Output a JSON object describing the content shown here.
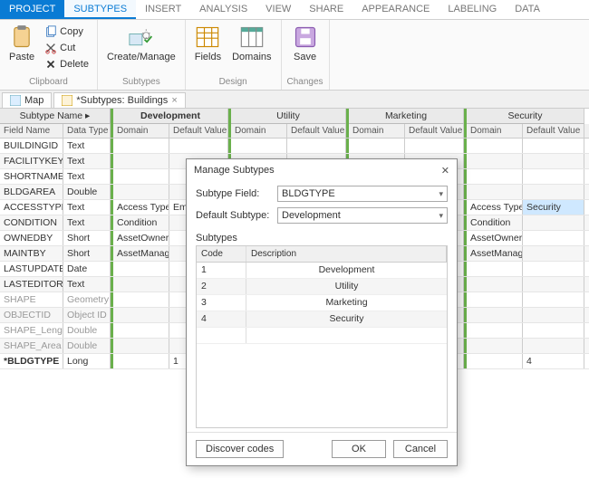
{
  "ribbonTabs": [
    "PROJECT",
    "SUBTYPES",
    "INSERT",
    "ANALYSIS",
    "VIEW",
    "SHARE",
    "APPEARANCE",
    "LABELING",
    "DATA"
  ],
  "activeTab": 1,
  "clipboard": {
    "copy": "Copy",
    "cut": "Cut",
    "delete": "Delete",
    "paste": "Paste",
    "label": "Clipboard"
  },
  "subtypesGroup": {
    "createManage": "Create/Manage",
    "label": "Subtypes"
  },
  "designGroup": {
    "fields": "Fields",
    "domains": "Domains",
    "label": "Design"
  },
  "changesGroup": {
    "save": "Save",
    "label": "Changes"
  },
  "docTabs": {
    "map": "Map",
    "subtypes": "*Subtypes: Buildings"
  },
  "gridHeaders": {
    "subtypeName": "Subtype Name ▸",
    "cols": [
      "Development",
      "Utility",
      "Marketing",
      "Security"
    ],
    "fieldName": "Field Name",
    "dataType": "Data Type",
    "domain": "Domain",
    "defaultValue": "Default Value"
  },
  "rows": [
    {
      "fn": "BUILDINGID",
      "dt": "Text"
    },
    {
      "fn": "FACILITYKEY",
      "dt": "Text"
    },
    {
      "fn": "SHORTNAME",
      "dt": "Text"
    },
    {
      "fn": "BLDGAREA",
      "dt": "Double"
    },
    {
      "fn": "ACCESSTYPE",
      "dt": "Text",
      "dom0": "Access Type",
      "dv0": "Emp",
      "dom3": "Access Type",
      "dv3": "Security",
      "hl3": true
    },
    {
      "fn": "CONDITION",
      "dt": "Text",
      "dom0": "Condition",
      "dom3": "Condition"
    },
    {
      "fn": "OWNEDBY",
      "dt": "Short",
      "dom0": "AssetOwner",
      "dom3": "AssetOwner"
    },
    {
      "fn": "MAINTBY",
      "dt": "Short",
      "dom0": "AssetManager",
      "dom3": "AssetManager"
    },
    {
      "fn": "LASTUPDATE",
      "dt": "Date"
    },
    {
      "fn": "LASTEDITOR",
      "dt": "Text"
    },
    {
      "fn": "SHAPE",
      "dt": "Geometry",
      "gray": true
    },
    {
      "fn": "OBJECTID",
      "dt": "Object ID",
      "gray": true
    },
    {
      "fn": "SHAPE_Length",
      "dt": "Double",
      "gray": true
    },
    {
      "fn": "SHAPE_Area",
      "dt": "Double",
      "gray": true
    },
    {
      "fn": "*BLDGTYPE",
      "dt": "Long",
      "bold": true,
      "dv0": "1",
      "dv3": "4"
    }
  ],
  "dialog": {
    "title": "Manage Subtypes",
    "subtypeFieldLabel": "Subtype Field:",
    "subtypeFieldValue": "BLDGTYPE",
    "defaultSubtypeLabel": "Default Subtype:",
    "defaultSubtypeValue": "Development",
    "subtypesLabel": "Subtypes",
    "codeHeader": "Code",
    "descHeader": "Description",
    "items": [
      {
        "code": "1",
        "desc": "Development"
      },
      {
        "code": "2",
        "desc": "Utility"
      },
      {
        "code": "3",
        "desc": "Marketing"
      },
      {
        "code": "4",
        "desc": "Security"
      }
    ],
    "discover": "Discover codes",
    "ok": "OK",
    "cancel": "Cancel"
  }
}
